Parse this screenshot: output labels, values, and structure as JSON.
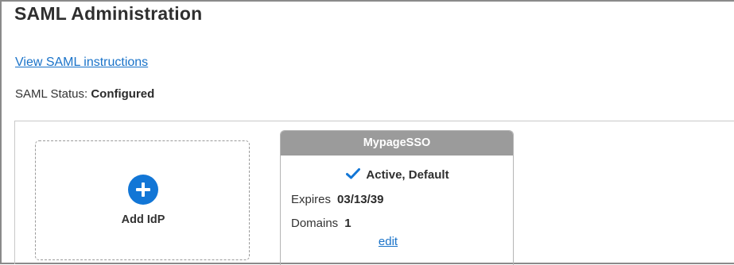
{
  "page": {
    "title": "SAML Administration",
    "instructions_link": "View SAML instructions",
    "status_label": "SAML Status:",
    "status_value": "Configured"
  },
  "add_idp": {
    "label": "Add IdP",
    "icon": "plus-circle-icon"
  },
  "idp_card": {
    "name": "MypageSSO",
    "state": "Active, Default",
    "state_icon": "checkmark-icon",
    "expires_label": "Expires",
    "expires_value": "03/13/39",
    "domains_label": "Domains",
    "domains_value": "1",
    "edit_label": "edit"
  },
  "colors": {
    "accent": "#1276d6",
    "link": "#1a73c9",
    "card_header": "#9b9b9b"
  }
}
